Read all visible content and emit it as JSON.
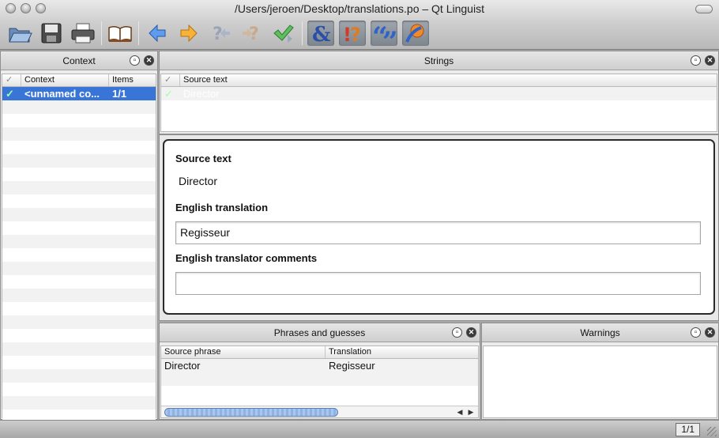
{
  "window": {
    "title": "/Users/jeroen/Desktop/translations.po – Qt Linguist"
  },
  "toolbar": {
    "items": [
      {
        "name": "open-icon"
      },
      {
        "name": "save-icon"
      },
      {
        "name": "print-icon"
      },
      {
        "name": "phrasebook-icon"
      },
      {
        "name": "previous-icon"
      },
      {
        "name": "next-icon"
      },
      {
        "name": "prev-unfinished-icon"
      },
      {
        "name": "next-unfinished-icon"
      },
      {
        "name": "done-next-icon"
      },
      {
        "name": "accelerators-icon"
      },
      {
        "name": "ending-punctuation-icon"
      },
      {
        "name": "phrase-matches-icon"
      },
      {
        "name": "place-markers-icon"
      }
    ]
  },
  "context_dock": {
    "title": "Context",
    "columns": [
      "Context",
      "Items"
    ],
    "rows": [
      {
        "context": "<unnamed co...",
        "items": "1/1"
      }
    ]
  },
  "strings_dock": {
    "title": "Strings",
    "columns": [
      "Source text"
    ],
    "rows": [
      {
        "source": "Director"
      }
    ]
  },
  "editor": {
    "source_label": "Source text",
    "source_value": "Director",
    "translation_label": "English translation",
    "translation_value": "Regisseur",
    "comments_label": "English translator comments",
    "comments_value": ""
  },
  "phrases_dock": {
    "title": "Phrases and guesses",
    "columns": [
      "Source phrase",
      "Translation"
    ],
    "rows": [
      {
        "source": "Director",
        "translation": "Regisseur"
      }
    ]
  },
  "warnings_dock": {
    "title": "Warnings"
  },
  "status": {
    "counter": "1/1"
  },
  "colors": {
    "selection": "#3875d7",
    "check": "#2a9d2a"
  }
}
